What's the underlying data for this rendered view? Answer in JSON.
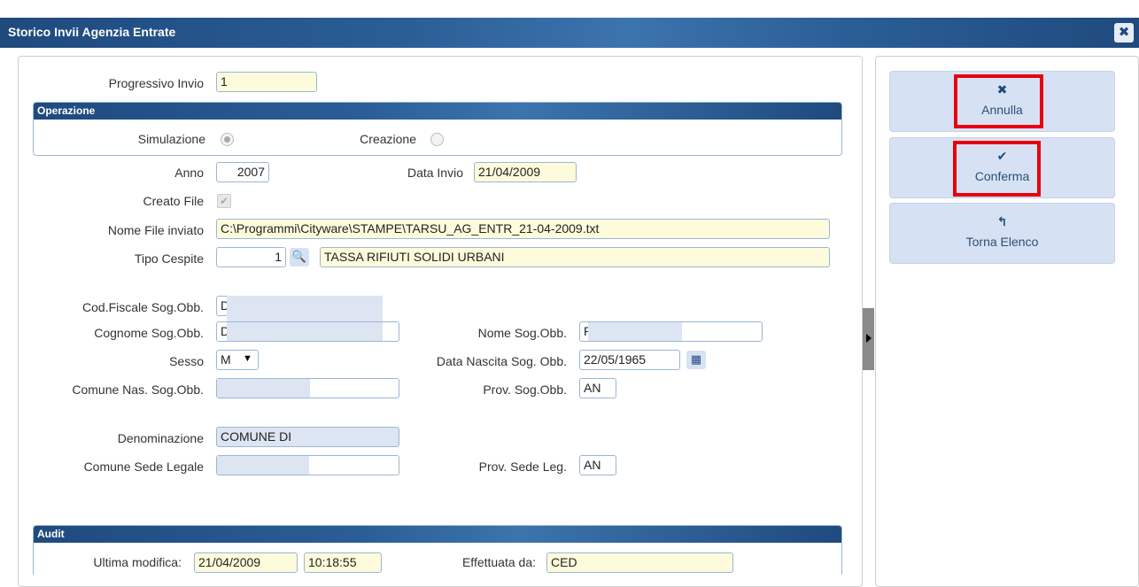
{
  "window": {
    "title": "Storico Invii Agenzia Entrate",
    "close_icon": "close-icon"
  },
  "form": {
    "progressivo": {
      "label": "Progressivo Invio",
      "value": "1"
    },
    "operazione": {
      "title": "Operazione",
      "simulazione": {
        "label": "Simulazione",
        "checked": true
      },
      "creazione": {
        "label": "Creazione",
        "checked": false
      }
    },
    "anno": {
      "label": "Anno",
      "value": "2007"
    },
    "data_invio": {
      "label": "Data Invio",
      "value": "21/04/2009"
    },
    "creato_file": {
      "label": "Creato File",
      "checked": true
    },
    "nome_file": {
      "label": "Nome File inviato",
      "value": "C:\\Programmi\\Cityware\\STAMPE\\TARSU_AG_ENTR_21-04-2009.txt"
    },
    "tipo_cespite": {
      "label": "Tipo Cespite",
      "code": "1",
      "description": "TASSA RIFIUTI SOLIDI URBANI"
    },
    "cod_fiscale": {
      "label": "Cod.Fiscale Sog.Obb.",
      "value": "D"
    },
    "cognome": {
      "label": "Cognome Sog.Obb.",
      "value": "D"
    },
    "nome": {
      "label": "Nome Sog.Obb.",
      "value": "R"
    },
    "sesso": {
      "label": "Sesso",
      "value": "M"
    },
    "data_nascita": {
      "label": "Data Nascita Sog. Obb.",
      "value": "22/05/1965"
    },
    "comune_nascita": {
      "label": "Comune Nas. Sog.Obb.",
      "value": ""
    },
    "prov_nascita": {
      "label": "Prov. Sog.Obb.",
      "value": "AN"
    },
    "denominazione": {
      "label": "Denominazione",
      "value": "COMUNE DI"
    },
    "comune_sede": {
      "label": "Comune Sede Legale",
      "value": ""
    },
    "prov_sede": {
      "label": "Prov. Sede Leg.",
      "value": "AN"
    },
    "audit": {
      "title": "Audit",
      "ultima_label": "Ultima modifica:",
      "data": "21/04/2009",
      "ora": "10:18:55",
      "effettuata_label": "Effettuata da:",
      "utente": "CED"
    }
  },
  "actions": {
    "annulla": {
      "label": "Annulla",
      "icon": "x-icon",
      "glyph": "✖"
    },
    "conferma": {
      "label": "Conferma",
      "icon": "check-icon",
      "glyph": "✔"
    },
    "torna": {
      "label": "Torna Elenco",
      "icon": "back-arrow-icon",
      "glyph": "↰"
    }
  },
  "colors": {
    "title_bar": "#1f4a7e",
    "highlight": "#e8000d",
    "input_yellow": "#fdfbdb",
    "button": "#d6e2f3"
  }
}
